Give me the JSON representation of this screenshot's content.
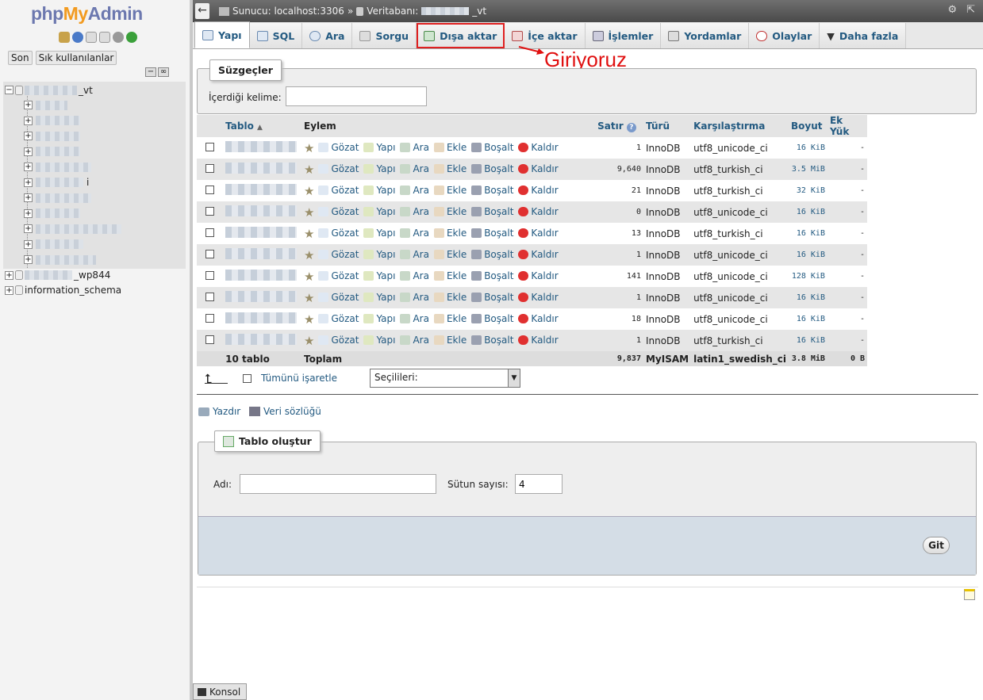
{
  "logo": {
    "php": "php",
    "my": "My",
    "admin": "Admin"
  },
  "left": {
    "recent_label": "Son",
    "favorites_label": "Sık kullanılanlar",
    "databases": [
      {
        "name": "_vt",
        "expanded": true
      },
      {
        "name": "_wp844",
        "expanded": false
      },
      {
        "name": "information_schema",
        "expanded": false
      }
    ],
    "sub_tables_count": 11,
    "sub_suffix_i": "i"
  },
  "topbar": {
    "server_label": "Sunucu: localhost:3306",
    "separator": "»",
    "db_label": "Veritabanı:",
    "db_name": "_vt"
  },
  "tabs": [
    {
      "label": "Yapı",
      "icon": "structure-icon",
      "active": true
    },
    {
      "label": "SQL",
      "icon": "sql-icon"
    },
    {
      "label": "Ara",
      "icon": "search-icon"
    },
    {
      "label": "Sorgu",
      "icon": "query-icon"
    },
    {
      "label": "Dışa aktar",
      "icon": "export-icon",
      "highlighted": true
    },
    {
      "label": "İçe aktar",
      "icon": "import-icon"
    },
    {
      "label": "İşlemler",
      "icon": "wrench-icon"
    },
    {
      "label": "Yordamlar",
      "icon": "routines-icon"
    },
    {
      "label": "Olaylar",
      "icon": "clock-icon"
    },
    {
      "label": "Daha fazla",
      "icon": "chevron-down-icon"
    }
  ],
  "annotation": "Giriyoruz",
  "filter": {
    "legend": "Süzgeçler",
    "label": "İçerdiği kelime:",
    "value": ""
  },
  "table": {
    "headers": {
      "name": "Tablo",
      "action": "Eylem",
      "rows": "Satır",
      "type": "Türü",
      "collation": "Karşılaştırma",
      "size": "Boyut",
      "overhead": "Ek Yük"
    },
    "actions": {
      "browse": "Gözat",
      "structure": "Yapı",
      "search": "Ara",
      "insert": "Ekle",
      "empty": "Boşalt",
      "drop": "Kaldır"
    },
    "rows": [
      {
        "rows": "1",
        "type": "InnoDB",
        "collation": "utf8_unicode_ci",
        "size": "16 KiB",
        "overhead": "-"
      },
      {
        "rows": "9,640",
        "type": "InnoDB",
        "collation": "utf8_turkish_ci",
        "size": "3.5 MiB",
        "overhead": "-"
      },
      {
        "rows": "21",
        "type": "InnoDB",
        "collation": "utf8_turkish_ci",
        "size": "32 KiB",
        "overhead": "-"
      },
      {
        "rows": "0",
        "type": "InnoDB",
        "collation": "utf8_unicode_ci",
        "size": "16 KiB",
        "overhead": "-"
      },
      {
        "rows": "13",
        "type": "InnoDB",
        "collation": "utf8_turkish_ci",
        "size": "16 KiB",
        "overhead": "-"
      },
      {
        "rows": "1",
        "type": "InnoDB",
        "collation": "utf8_unicode_ci",
        "size": "16 KiB",
        "overhead": "-"
      },
      {
        "rows": "141",
        "type": "InnoDB",
        "collation": "utf8_unicode_ci",
        "size": "128 KiB",
        "overhead": "-"
      },
      {
        "rows": "1",
        "type": "InnoDB",
        "collation": "utf8_unicode_ci",
        "size": "16 KiB",
        "overhead": "-"
      },
      {
        "rows": "18",
        "type": "InnoDB",
        "collation": "utf8_unicode_ci",
        "size": "16 KiB",
        "overhead": "-"
      },
      {
        "rows": "1",
        "type": "InnoDB",
        "collation": "utf8_turkish_ci",
        "size": "16 KiB",
        "overhead": "-"
      }
    ],
    "footer": {
      "count": "10 tablo",
      "total": "Toplam",
      "rows": "9,837",
      "type": "MyISAM",
      "collation": "latin1_swedish_ci",
      "size": "3.8 MiB",
      "overhead": "0 B"
    }
  },
  "bulk": {
    "check_all": "Tümünü işaretle",
    "with_selected": "Seçilileri:"
  },
  "print_links": {
    "print": "Yazdır",
    "data_dict": "Veri sözlüğü"
  },
  "create": {
    "legend": "Tablo oluştur",
    "name_label": "Adı:",
    "name_value": "",
    "columns_label": "Sütun sayısı:",
    "columns_value": "4",
    "go": "Git"
  },
  "console": "Konsol"
}
